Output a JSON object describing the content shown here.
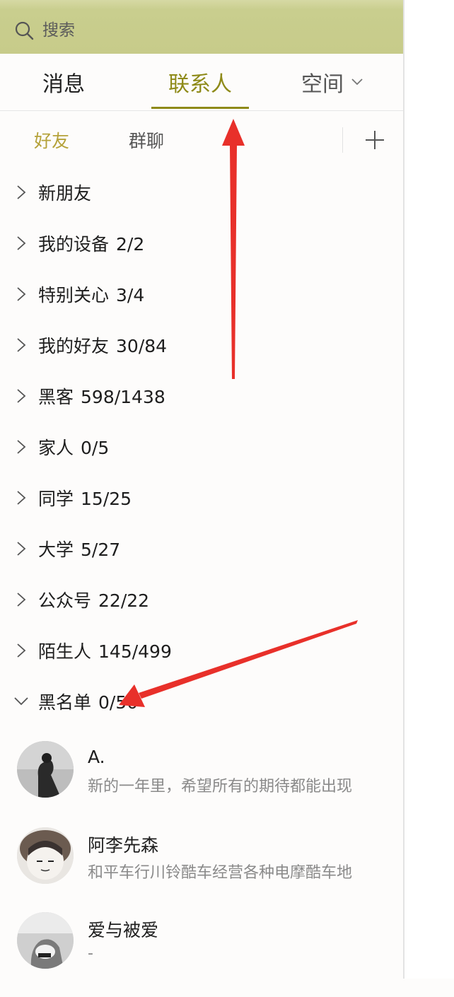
{
  "search": {
    "placeholder": "搜索"
  },
  "tabs": [
    {
      "label": "消息"
    },
    {
      "label": "联系人",
      "active": true
    },
    {
      "label": "空间"
    }
  ],
  "subtabs": [
    {
      "label": "好友",
      "active": true
    },
    {
      "label": "群聊"
    }
  ],
  "groups": [
    {
      "name": "新朋友",
      "count": ""
    },
    {
      "name": "我的设备",
      "count": "2/2"
    },
    {
      "name": "特别关心",
      "count": "3/4"
    },
    {
      "name": "我的好友",
      "count": "30/84"
    },
    {
      "name": "黑客",
      "count": "598/1438"
    },
    {
      "name": "家人",
      "count": "0/5"
    },
    {
      "name": "同学",
      "count": "15/25"
    },
    {
      "name": "大学",
      "count": "5/27"
    },
    {
      "name": "公众号",
      "count": "22/22"
    },
    {
      "name": "陌生人",
      "count": "145/499"
    },
    {
      "name": "黑名单",
      "count": "0/50",
      "expanded": true
    }
  ],
  "contacts": [
    {
      "name": "A.",
      "signature": "新的一年里，希望所有的期待都能出现"
    },
    {
      "name": "阿李先森",
      "signature": "和平车行川铃酷车经营各种电摩酷车地"
    },
    {
      "name": "爱与被爱",
      "signature": "-"
    }
  ],
  "colors": {
    "header_bg": "#c7cb8a",
    "accent": "#8e8a18",
    "subtab_active": "#b5a23a",
    "annotation_arrow": "#e8302a"
  }
}
